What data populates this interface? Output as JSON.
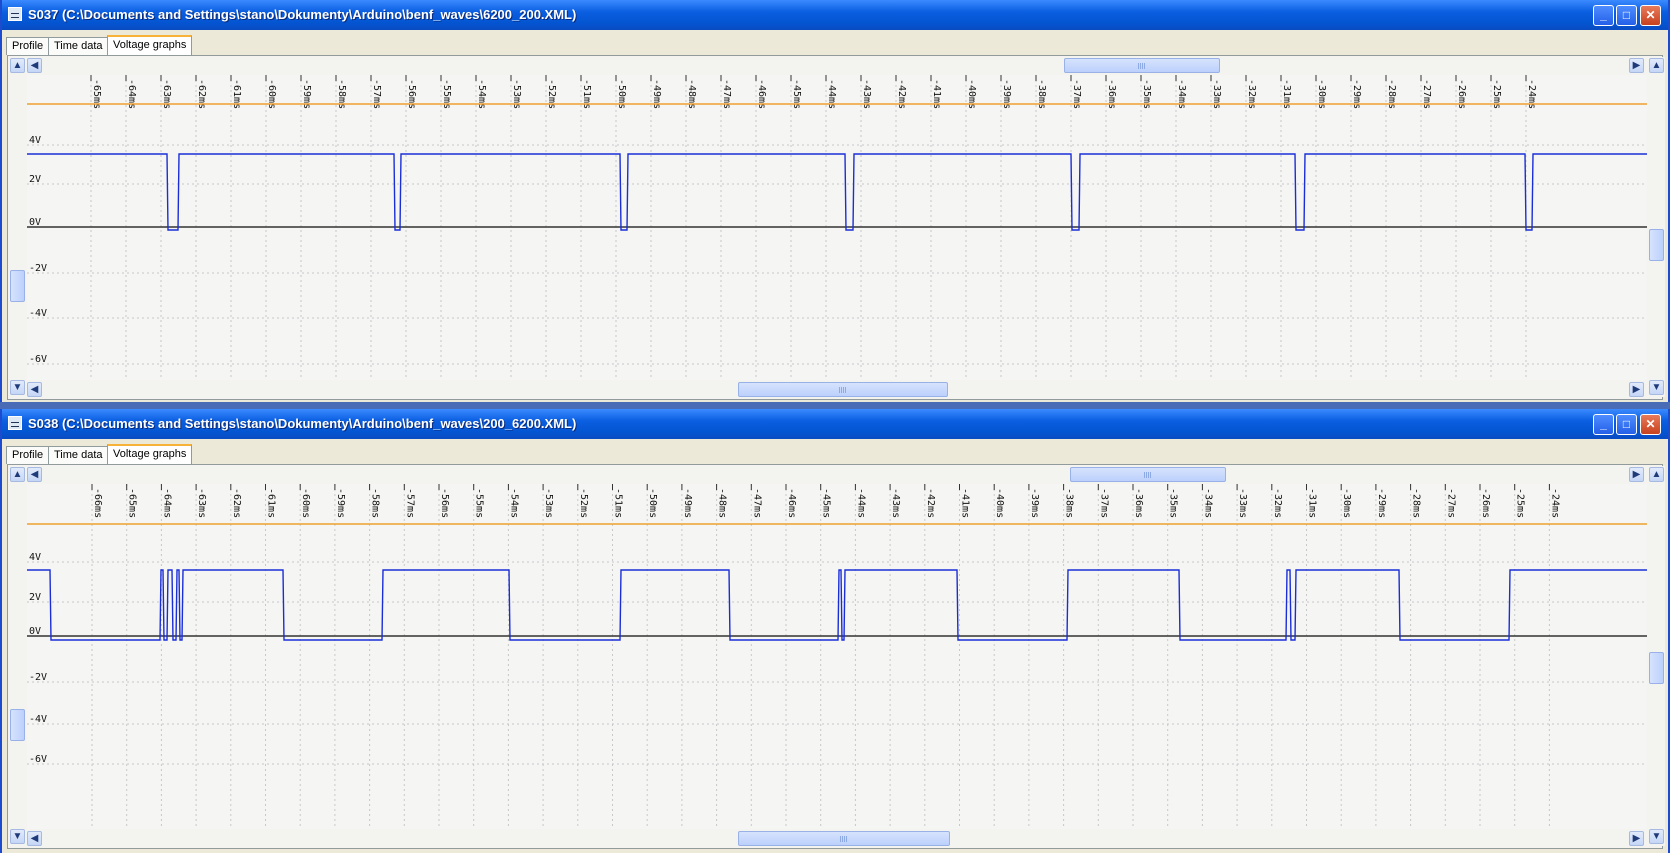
{
  "windows": [
    {
      "title": "S037 (C:\\Documents and Settings\\stano\\Dokumenty\\Arduino\\benf_waves\\6200_200.XML)",
      "tabs": [
        "Profile",
        "Time data",
        "Voltage graphs"
      ],
      "active_tab": "Voltage graphs",
      "time_ticks": [
        "-65ms",
        "-64ms",
        "-63ms",
        "-62ms",
        "-61ms",
        "-60ms",
        "-59ms",
        "-58ms",
        "-57ms",
        "-56ms",
        "-55ms",
        "-54ms",
        "-53ms",
        "-52ms",
        "-51ms",
        "-50ms",
        "-49ms",
        "-48ms",
        "-47ms",
        "-46ms",
        "-45ms",
        "-44ms",
        "-43ms",
        "-42ms",
        "-41ms",
        "-40ms",
        "-39ms",
        "-38ms",
        "-37ms",
        "-36ms",
        "-35ms",
        "-34ms",
        "-33ms",
        "-32ms",
        "-31ms",
        "-30ms",
        "-29ms",
        "-28ms",
        "-27ms",
        "-26ms",
        "-25ms",
        "-24ms"
      ],
      "voltage_labels": [
        "4V",
        "2V",
        "0V",
        "-2V",
        "-4V",
        "-6V"
      ]
    },
    {
      "title": "S038 (C:\\Documents and Settings\\stano\\Dokumenty\\Arduino\\benf_waves\\200_6200.XML)",
      "tabs": [
        "Profile",
        "Time data",
        "Voltage graphs"
      ],
      "active_tab": "Voltage graphs",
      "time_ticks": [
        "-66ms",
        "-65ms",
        "-64ms",
        "-63ms",
        "-62ms",
        "-61ms",
        "-60ms",
        "-59ms",
        "-58ms",
        "-57ms",
        "-56ms",
        "-55ms",
        "-54ms",
        "-53ms",
        "-52ms",
        "-51ms",
        "-50ms",
        "-49ms",
        "-48ms",
        "-47ms",
        "-46ms",
        "-45ms",
        "-44ms",
        "-43ms",
        "-42ms",
        "-41ms",
        "-40ms",
        "-39ms",
        "-38ms",
        "-37ms",
        "-36ms",
        "-35ms",
        "-34ms",
        "-33ms",
        "-32ms",
        "-31ms",
        "-30ms",
        "-29ms",
        "-28ms",
        "-27ms",
        "-26ms",
        "-25ms",
        "-24ms"
      ],
      "voltage_labels": [
        "4V",
        "2V",
        "0V",
        "-2V",
        "-4V",
        "-6V"
      ]
    }
  ],
  "colors": {
    "signal": "#1a2ed8",
    "reference_line": "#f0a030",
    "zero_line": "#333333",
    "grid": "#c8c8c8"
  },
  "icons": {
    "minimize": "minimize-icon",
    "maximize": "maximize-icon",
    "close": "close-icon"
  }
}
